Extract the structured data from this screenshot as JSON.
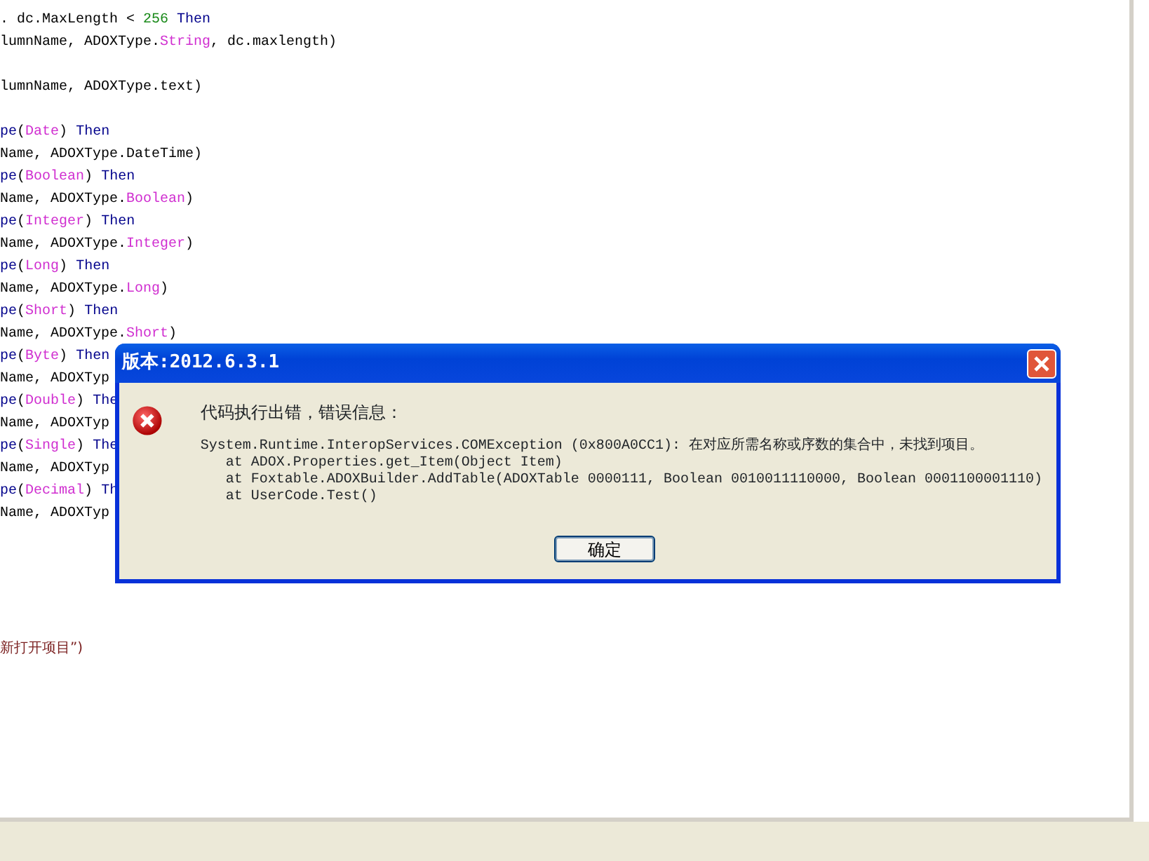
{
  "editor": {
    "lines": [
      {
        "kind": "code",
        "segments": [
          {
            "text": ". dc.MaxLength < ",
            "kind": "plain"
          },
          {
            "text": "256",
            "kind": "number"
          },
          {
            "text": " Then",
            "kind": "keyword"
          }
        ]
      },
      {
        "kind": "code",
        "segments": [
          {
            "text": "lumnName, ADOXType.",
            "kind": "plain"
          },
          {
            "text": "String",
            "kind": "type"
          },
          {
            "text": ", dc.maxlength)",
            "kind": "plain"
          }
        ]
      },
      {
        "kind": "blank"
      },
      {
        "kind": "code",
        "segments": [
          {
            "text": "lumnName, ADOXType.text)",
            "kind": "plain"
          }
        ]
      },
      {
        "kind": "blank"
      },
      {
        "kind": "code",
        "segments": [
          {
            "text": "pe",
            "kind": "keyword"
          },
          {
            "text": "(",
            "kind": "plain"
          },
          {
            "text": "Date",
            "kind": "type"
          },
          {
            "text": ") ",
            "kind": "plain"
          },
          {
            "text": "Then",
            "kind": "keyword"
          }
        ]
      },
      {
        "kind": "code",
        "segments": [
          {
            "text": "Name, ADOXType.DateTime)",
            "kind": "plain"
          }
        ]
      },
      {
        "kind": "code",
        "segments": [
          {
            "text": "pe",
            "kind": "keyword"
          },
          {
            "text": "(",
            "kind": "plain"
          },
          {
            "text": "Boolean",
            "kind": "type"
          },
          {
            "text": ") ",
            "kind": "plain"
          },
          {
            "text": "Then",
            "kind": "keyword"
          }
        ]
      },
      {
        "kind": "code",
        "segments": [
          {
            "text": "Name, ADOXType.",
            "kind": "plain"
          },
          {
            "text": "Boolean",
            "kind": "type"
          },
          {
            "text": ")",
            "kind": "plain"
          }
        ]
      },
      {
        "kind": "code",
        "segments": [
          {
            "text": "pe",
            "kind": "keyword"
          },
          {
            "text": "(",
            "kind": "plain"
          },
          {
            "text": "Integer",
            "kind": "type"
          },
          {
            "text": ") ",
            "kind": "plain"
          },
          {
            "text": "Then",
            "kind": "keyword"
          }
        ]
      },
      {
        "kind": "code",
        "segments": [
          {
            "text": "Name, ADOXType.",
            "kind": "plain"
          },
          {
            "text": "Integer",
            "kind": "type"
          },
          {
            "text": ")",
            "kind": "plain"
          }
        ]
      },
      {
        "kind": "code",
        "segments": [
          {
            "text": "pe",
            "kind": "keyword"
          },
          {
            "text": "(",
            "kind": "plain"
          },
          {
            "text": "Long",
            "kind": "type"
          },
          {
            "text": ") ",
            "kind": "plain"
          },
          {
            "text": "Then",
            "kind": "keyword"
          }
        ]
      },
      {
        "kind": "code",
        "segments": [
          {
            "text": "Name, ADOXType.",
            "kind": "plain"
          },
          {
            "text": "Long",
            "kind": "type"
          },
          {
            "text": ")",
            "kind": "plain"
          }
        ]
      },
      {
        "kind": "code",
        "segments": [
          {
            "text": "pe",
            "kind": "keyword"
          },
          {
            "text": "(",
            "kind": "plain"
          },
          {
            "text": "Short",
            "kind": "type"
          },
          {
            "text": ") ",
            "kind": "plain"
          },
          {
            "text": "Then",
            "kind": "keyword"
          }
        ]
      },
      {
        "kind": "code",
        "segments": [
          {
            "text": "Name, ADOXType.",
            "kind": "plain"
          },
          {
            "text": "Short",
            "kind": "type"
          },
          {
            "text": ")",
            "kind": "plain"
          }
        ]
      },
      {
        "kind": "code",
        "segments": [
          {
            "text": "pe",
            "kind": "keyword"
          },
          {
            "text": "(",
            "kind": "plain"
          },
          {
            "text": "Byte",
            "kind": "type"
          },
          {
            "text": ") ",
            "kind": "plain"
          },
          {
            "text": "Then",
            "kind": "keyword"
          }
        ]
      },
      {
        "kind": "code",
        "segments": [
          {
            "text": "Name, ADOXTyp",
            "kind": "plain"
          }
        ]
      },
      {
        "kind": "code",
        "segments": [
          {
            "text": "pe",
            "kind": "keyword"
          },
          {
            "text": "(",
            "kind": "plain"
          },
          {
            "text": "Double",
            "kind": "type"
          },
          {
            "text": ") ",
            "kind": "plain"
          },
          {
            "text": "The",
            "kind": "keyword"
          }
        ]
      },
      {
        "kind": "code",
        "segments": [
          {
            "text": "Name, ADOXTyp",
            "kind": "plain"
          }
        ]
      },
      {
        "kind": "code",
        "segments": [
          {
            "text": "pe",
            "kind": "keyword"
          },
          {
            "text": "(",
            "kind": "plain"
          },
          {
            "text": "Single",
            "kind": "type"
          },
          {
            "text": ") ",
            "kind": "plain"
          },
          {
            "text": "The",
            "kind": "keyword"
          }
        ]
      },
      {
        "kind": "code",
        "segments": [
          {
            "text": "Name, ADOXTyp",
            "kind": "plain"
          }
        ]
      },
      {
        "kind": "code",
        "segments": [
          {
            "text": "pe",
            "kind": "keyword"
          },
          {
            "text": "(",
            "kind": "plain"
          },
          {
            "text": "Decimal",
            "kind": "type"
          },
          {
            "text": ") ",
            "kind": "plain"
          },
          {
            "text": "Th",
            "kind": "keyword"
          }
        ]
      },
      {
        "kind": "code",
        "segments": [
          {
            "text": "Name, ADOXTyp",
            "kind": "plain"
          }
        ]
      },
      {
        "kind": "blank"
      },
      {
        "kind": "blank"
      },
      {
        "kind": "blank"
      },
      {
        "kind": "blank"
      },
      {
        "kind": "blank"
      },
      {
        "kind": "code",
        "segments": [
          {
            "text": "新打开项目”)",
            "kind": "string"
          }
        ]
      }
    ]
  },
  "dialog": {
    "title": "版本:2012.6.3.1",
    "heading": "代码执行出错，错误信息：",
    "details": [
      {
        "kind": "message",
        "text": "System.Runtime.InteropServices.COMException (0x800A0CC1): 在对应所需名称或序数的集合中，未找到项目。"
      },
      {
        "kind": "frame",
        "text": "at ADOX.Properties.get_Item(Object Item)"
      },
      {
        "kind": "frame",
        "text": "at Foxtable.ADOXBuilder.AddTable(ADOXTable 0000111, Boolean 0010011110000, Boolean 0001100001110)"
      },
      {
        "kind": "frame",
        "text": "at UserCode.Test()"
      }
    ],
    "button": "确定"
  }
}
